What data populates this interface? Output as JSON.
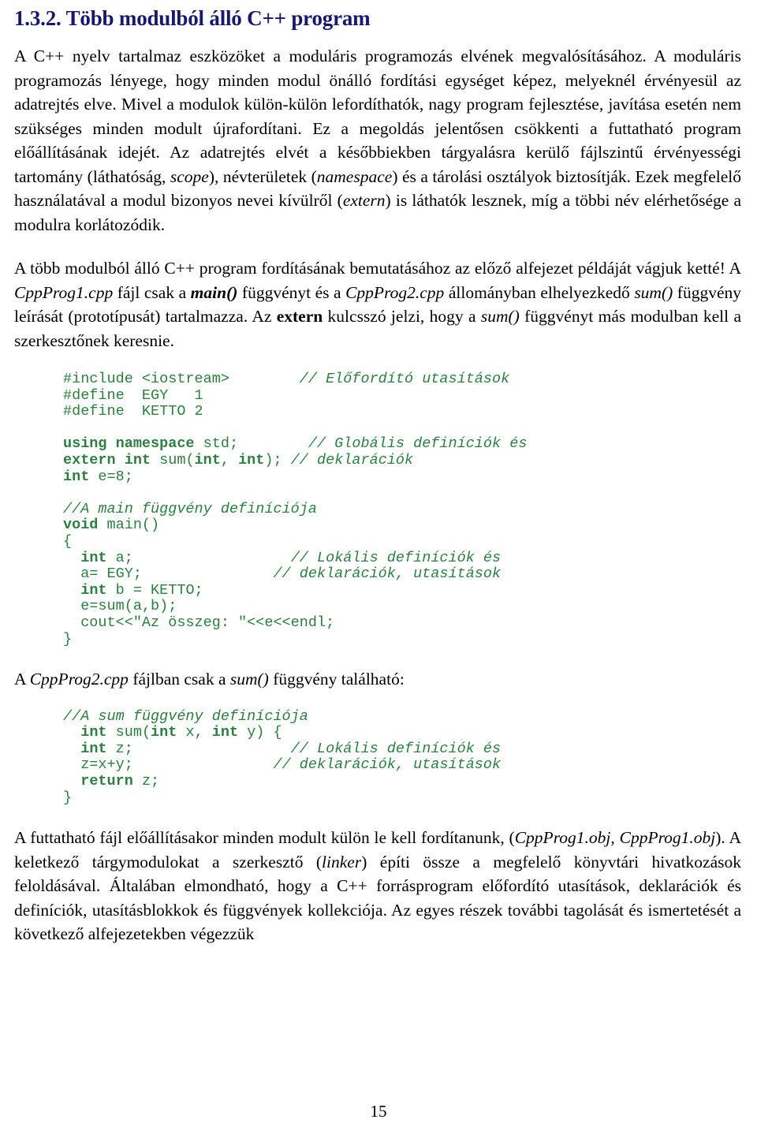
{
  "document": {
    "heading": "1.3.2. Több modulból álló C++ program",
    "page_number": "15",
    "heading_color": "#17176b",
    "code_color": "#2e7d41",
    "body_color": "#000000"
  },
  "paragraphs": {
    "p1": {
      "segments": [
        {
          "text": "A C++ nyelv tartalmaz eszközöket a moduláris programozás elvének megvalósításához. A moduláris programozás lényege, hogy minden modul önálló fordítási egységet képez, melyeknél érvényesül az adatrejtés elve. Mivel a modulok külön-külön lefordíthatók, nagy program fejlesztése, javítása esetén nem szükséges minden modult újrafordítani. Ez a megoldás jelentősen csökkenti a futtatható program előállításának idejét. Az adatrejtés elvét a későbbiekben tárgyalásra kerülő fájlszintű érvényességi tartomány (láthatóság, ",
          "style": "normal"
        },
        {
          "text": "scope",
          "style": "italic"
        },
        {
          "text": "), névterületek (",
          "style": "normal"
        },
        {
          "text": "namespace",
          "style": "italic"
        },
        {
          "text": ") és a tárolási osztályok biztosítják. Ezek megfelelő használatával a modul bizonyos nevei kívülről (",
          "style": "normal"
        },
        {
          "text": "extern",
          "style": "italic"
        },
        {
          "text": ") is láthatók lesznek, míg a többi név elérhetősége a modulra korlátozódik.",
          "style": "normal"
        }
      ]
    },
    "p2": {
      "segments": [
        {
          "text": "A több modulból álló C++ program fordításának bemutatásához az előző alfejezet példáját vágjuk ketté! A ",
          "style": "normal"
        },
        {
          "text": "CppProg1.cpp",
          "style": "italic"
        },
        {
          "text": " fájl csak a ",
          "style": "normal"
        },
        {
          "text": "main()",
          "style": "bold-italic"
        },
        {
          "text": " függvényt és a ",
          "style": "normal"
        },
        {
          "text": "CppProg2.cpp",
          "style": "italic"
        },
        {
          "text": " állományban elhelyezkedő ",
          "style": "normal"
        },
        {
          "text": "sum()",
          "style": "italic"
        },
        {
          "text": " függvény leírását (prototípusát) tartalmazza. Az ",
          "style": "normal"
        },
        {
          "text": "extern",
          "style": "bold"
        },
        {
          "text": " kulcsszó jelzi, hogy a ",
          "style": "normal"
        },
        {
          "text": "sum()",
          "style": "italic"
        },
        {
          "text": " függvényt más modulban kell a szerkesztőnek keresnie.",
          "style": "normal"
        }
      ]
    },
    "p3": {
      "segments": [
        {
          "text": "A ",
          "style": "normal"
        },
        {
          "text": "CppProg2.cpp",
          "style": "italic"
        },
        {
          "text": " fájlban csak a ",
          "style": "normal"
        },
        {
          "text": "sum()",
          "style": "italic"
        },
        {
          "text": " függvény található:",
          "style": "normal"
        }
      ]
    },
    "p4": {
      "segments": [
        {
          "text": "A futtatható fájl előállításakor minden modult külön le kell fordítanunk, (",
          "style": "normal"
        },
        {
          "text": "CppProg1.obj",
          "style": "italic"
        },
        {
          "text": ", ",
          "style": "normal"
        },
        {
          "text": "CppProg1.obj",
          "style": "italic"
        },
        {
          "text": "). A keletkező tárgymodulokat a szerkesztő (",
          "style": "normal"
        },
        {
          "text": "linker",
          "style": "italic"
        },
        {
          "text": ") építi össze a megfelelő könyvtári hivatkozások feloldásával. Általában elmondható, hogy a C++ forrásprogram előfordító utasítások, deklarációk és definíciók, utasításblokkok és függvények kollekciója. Az egyes részek további tagolását és ismertetését a következő alfejezetekben végezzük",
          "style": "normal"
        }
      ]
    }
  },
  "code_blocks": {
    "cpp_prog1": {
      "filename_reference": "CppProg1.cpp",
      "lines": [
        {
          "tokens": [
            {
              "t": "#include <iostream>",
              "s": "plain"
            },
            {
              "t": "        ",
              "s": "plain"
            },
            {
              "t": "// Előfordító utasítások",
              "s": "comment"
            }
          ]
        },
        {
          "tokens": [
            {
              "t": "#define  EGY   1",
              "s": "plain"
            }
          ]
        },
        {
          "tokens": [
            {
              "t": "#define  KETTO 2",
              "s": "plain"
            }
          ]
        },
        {
          "tokens": [
            {
              "t": "",
              "s": "plain"
            }
          ]
        },
        {
          "tokens": [
            {
              "t": "using namespace",
              "s": "keyword"
            },
            {
              "t": " std;",
              "s": "plain"
            },
            {
              "t": "        ",
              "s": "plain"
            },
            {
              "t": "// Globális definíciók és",
              "s": "comment"
            }
          ]
        },
        {
          "tokens": [
            {
              "t": "extern int",
              "s": "keyword"
            },
            {
              "t": " sum(",
              "s": "plain"
            },
            {
              "t": "int",
              "s": "keyword"
            },
            {
              "t": ", ",
              "s": "plain"
            },
            {
              "t": "int",
              "s": "keyword"
            },
            {
              "t": "); ",
              "s": "plain"
            },
            {
              "t": "// deklarációk",
              "s": "comment"
            }
          ]
        },
        {
          "tokens": [
            {
              "t": "int",
              "s": "keyword"
            },
            {
              "t": " e=8;",
              "s": "plain"
            }
          ]
        },
        {
          "tokens": [
            {
              "t": "",
              "s": "plain"
            }
          ]
        },
        {
          "tokens": [
            {
              "t": "//A main függvény definíciója",
              "s": "comment"
            }
          ]
        },
        {
          "tokens": [
            {
              "t": "void",
              "s": "keyword"
            },
            {
              "t": " main()",
              "s": "plain"
            }
          ]
        },
        {
          "tokens": [
            {
              "t": "{",
              "s": "plain"
            }
          ]
        },
        {
          "tokens": [
            {
              "t": "  ",
              "s": "plain"
            },
            {
              "t": "int",
              "s": "keyword"
            },
            {
              "t": " a;",
              "s": "plain"
            },
            {
              "t": "                  ",
              "s": "plain"
            },
            {
              "t": "// Lokális definíciók és",
              "s": "comment"
            }
          ]
        },
        {
          "tokens": [
            {
              "t": "  a= EGY;",
              "s": "plain"
            },
            {
              "t": "               ",
              "s": "plain"
            },
            {
              "t": "// deklarációk, utasítások",
              "s": "comment"
            }
          ]
        },
        {
          "tokens": [
            {
              "t": "  ",
              "s": "plain"
            },
            {
              "t": "int",
              "s": "keyword"
            },
            {
              "t": " b = KETTO;",
              "s": "plain"
            }
          ]
        },
        {
          "tokens": [
            {
              "t": "  e=sum(a,b);",
              "s": "plain"
            }
          ]
        },
        {
          "tokens": [
            {
              "t": "  cout<<\"Az összeg: \"<<e<<endl;",
              "s": "plain"
            }
          ]
        },
        {
          "tokens": [
            {
              "t": "}",
              "s": "plain"
            }
          ]
        }
      ]
    },
    "cpp_prog2": {
      "filename_reference": "CppProg2.cpp",
      "lines": [
        {
          "tokens": [
            {
              "t": "//A sum függvény definíciója",
              "s": "comment"
            }
          ]
        },
        {
          "tokens": [
            {
              "t": "  ",
              "s": "plain"
            },
            {
              "t": "int",
              "s": "keyword"
            },
            {
              "t": " sum(",
              "s": "plain"
            },
            {
              "t": "int",
              "s": "keyword"
            },
            {
              "t": " x, ",
              "s": "plain"
            },
            {
              "t": "int",
              "s": "keyword"
            },
            {
              "t": " y) {",
              "s": "plain"
            }
          ]
        },
        {
          "tokens": [
            {
              "t": "  ",
              "s": "plain"
            },
            {
              "t": "int",
              "s": "keyword"
            },
            {
              "t": " z;",
              "s": "plain"
            },
            {
              "t": "                  ",
              "s": "plain"
            },
            {
              "t": "// Lokális definíciók és",
              "s": "comment"
            }
          ]
        },
        {
          "tokens": [
            {
              "t": "  z=x+y;",
              "s": "plain"
            },
            {
              "t": "                ",
              "s": "plain"
            },
            {
              "t": "// deklarációk, utasítások",
              "s": "comment"
            }
          ]
        },
        {
          "tokens": [
            {
              "t": "  ",
              "s": "plain"
            },
            {
              "t": "return",
              "s": "keyword"
            },
            {
              "t": " z;",
              "s": "plain"
            }
          ]
        },
        {
          "tokens": [
            {
              "t": "}",
              "s": "plain"
            }
          ]
        }
      ]
    }
  }
}
